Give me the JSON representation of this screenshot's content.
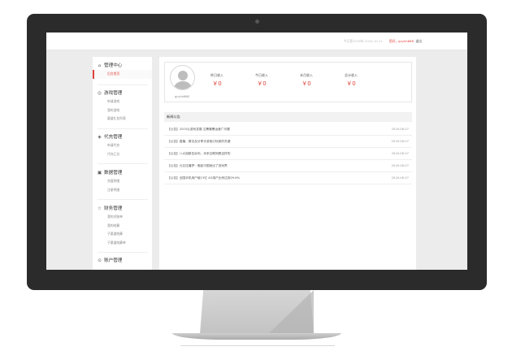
{
  "topbar": {
    "date_text": "今天是2016年-2015-10-21",
    "user_text": "您好，gcyhh666",
    "exit_label": "退出"
  },
  "sidebar": {
    "groups": [
      {
        "icon": "home-icon",
        "title": "管理中心",
        "items": [
          {
            "label": "后台首页",
            "active": true
          }
        ]
      },
      {
        "icon": "gamepad-icon",
        "title": "游戏管理",
        "items": [
          {
            "label": "申请游戏"
          },
          {
            "label": "我的游戏"
          },
          {
            "label": "渠道礼包列表"
          }
        ]
      },
      {
        "icon": "coin-icon",
        "title": "代充管理",
        "items": [
          {
            "label": "申请代充"
          },
          {
            "label": "代充汇总"
          }
        ]
      },
      {
        "icon": "chart-icon",
        "title": "数据管理",
        "items": [
          {
            "label": "充值明细"
          },
          {
            "label": "注册明细"
          }
        ]
      },
      {
        "icon": "star-icon",
        "title": "财务管理",
        "items": [
          {
            "label": "我的对账单"
          },
          {
            "label": "我的结算"
          },
          {
            "label": "子渠道结算"
          },
          {
            "label": "子渠道结算单"
          }
        ]
      },
      {
        "icon": "user-icon",
        "title": "账户管理",
        "items": []
      }
    ]
  },
  "profile": {
    "username": "gcyhh666",
    "stats": [
      {
        "label": "昨日收入",
        "value": "￥0"
      },
      {
        "label": "今日收入",
        "value": "￥0"
      },
      {
        "label": "本月收入",
        "value": "￥0"
      },
      {
        "label": "总计收入",
        "value": "￥0"
      }
    ]
  },
  "news": {
    "heading": "新闻公告",
    "items": [
      {
        "title": "【公告】2015公游戏发展 达需最需运营广问题",
        "date": "2016-06-07"
      },
      {
        "title": "【公告】直播、赛法及分享手游吸引玩家的关键",
        "date": "2016-06-07"
      },
      {
        "title": "【公告】八大指数告诉你，未来互联网是这样的",
        "date": "2016-06-07"
      },
      {
        "title": "【公告】元旦往播梦：假如中国就出了游戏界",
        "date": "2016-06-07"
      },
      {
        "title": "【公告】全国手机用户破13亿 4G用户比例达到29.6%",
        "date": "2016-06-07"
      }
    ]
  },
  "colors": {
    "accent": "#e0433c",
    "bezel": "#2b2b2b",
    "screen_bg": "#ececec"
  }
}
